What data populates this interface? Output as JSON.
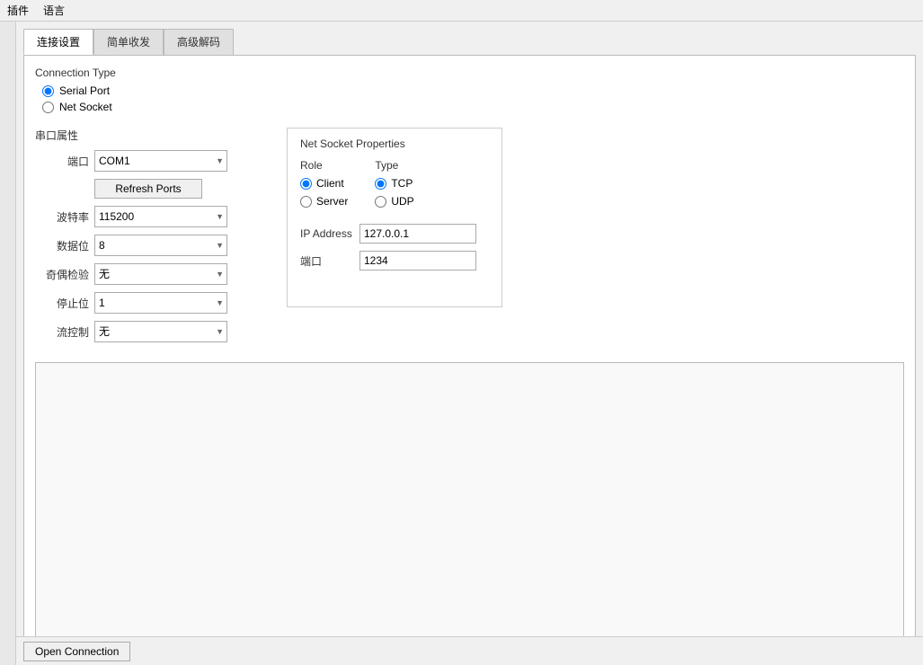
{
  "menu": {
    "items": [
      "插件",
      "语言"
    ]
  },
  "sidebar": {
    "tabs": []
  },
  "tabs": {
    "items": [
      {
        "label": "连接设置",
        "active": true
      },
      {
        "label": "简单收发",
        "active": false
      },
      {
        "label": "高级解码",
        "active": false
      }
    ]
  },
  "connection_type": {
    "label": "Connection Type",
    "options": [
      {
        "label": "Serial Port",
        "value": "serial",
        "checked": true
      },
      {
        "label": "Net Socket",
        "value": "net",
        "checked": false
      }
    ]
  },
  "serial_section": {
    "title": "串口属性",
    "fields": {
      "port_label": "端口",
      "port_value": "COM1",
      "refresh_btn": "Refresh Ports",
      "baud_label": "波特率",
      "baud_value": "115200",
      "data_bits_label": "数据位",
      "data_bits_value": "8",
      "parity_label": "奇偶检验",
      "parity_value": "无",
      "stop_bits_label": "停止位",
      "stop_bits_value": "1",
      "flow_label": "流控制",
      "flow_value": "无"
    }
  },
  "net_socket_section": {
    "title": "Net Socket Properties",
    "role_label": "Role",
    "type_label": "Type",
    "roles": [
      {
        "label": "Client",
        "checked": true
      },
      {
        "label": "Server",
        "checked": false
      }
    ],
    "types": [
      {
        "label": "TCP",
        "checked": true
      },
      {
        "label": "UDP",
        "checked": false
      }
    ],
    "ip_label": "IP Address",
    "ip_value": "127.0.0.1",
    "port_label": "端口",
    "port_value": "1234"
  },
  "bottom": {
    "open_btn": "Open Connection"
  }
}
